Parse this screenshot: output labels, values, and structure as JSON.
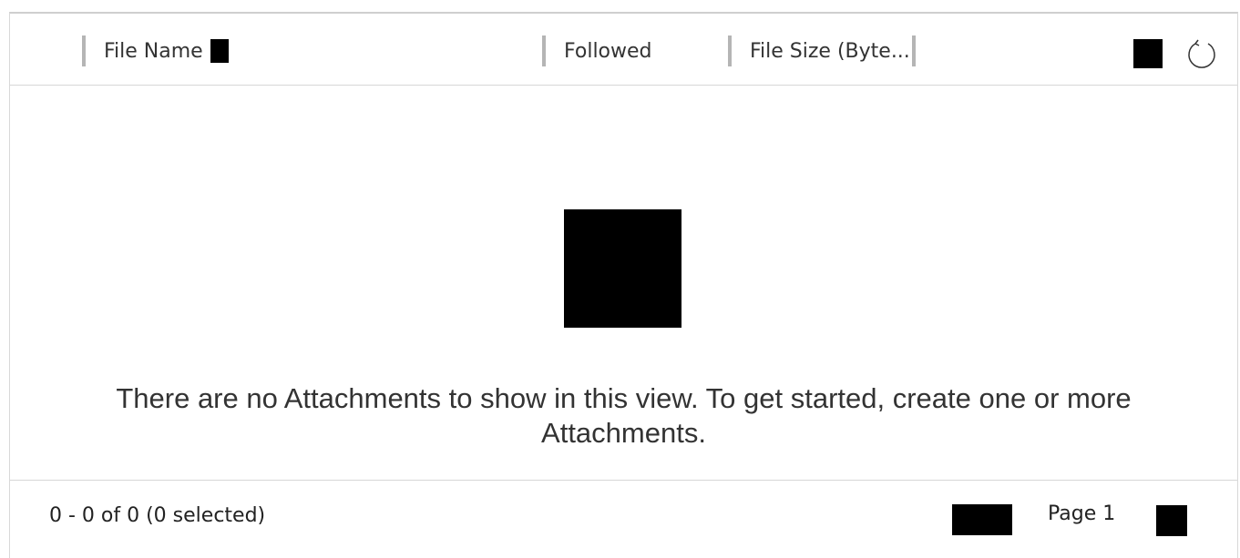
{
  "grid": {
    "columns": [
      {
        "label": "File Name",
        "sortable": true
      },
      {
        "label": "Followed"
      },
      {
        "label": "File Size (Byte..."
      }
    ],
    "toolbar": {
      "filter_icon": "filter-icon",
      "refresh_icon": "refresh-icon"
    }
  },
  "empty_state": {
    "icon": "empty-attachments-icon",
    "message": "There are no Attachments to show in this view. To get started, create one or more Attachments."
  },
  "footer": {
    "record_count": "0 - 0 of 0 (0 selected)",
    "page_label": "Page 1",
    "prev_icon": "previous-page-icon",
    "next_icon": "next-page-icon"
  }
}
